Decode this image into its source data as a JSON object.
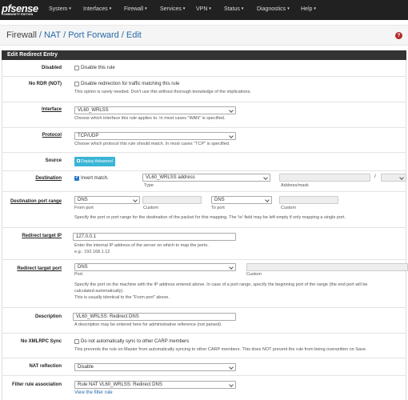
{
  "brand": {
    "logo_text": "pfsense",
    "edition": "COMMUNITY EDITION"
  },
  "nav": [
    "System",
    "Interfaces",
    "Firewall",
    "Services",
    "VPN",
    "Status",
    "Diagnostics",
    "Help"
  ],
  "breadcrumb": {
    "part1": "Firewall",
    "part2": "NAT",
    "part3": "Port Forward",
    "part4": "Edit"
  },
  "panel_title": "Edit Redirect Entry",
  "disabled": {
    "label": "Disabled",
    "checkbox_text": "Disable this rule",
    "checked": false
  },
  "no_rdr": {
    "label": "No RDR (NOT)",
    "checkbox_text": "Disable redirection for traffic matching this rule",
    "help": "This option is rarely needed. Don't use this without thorough knowledge of the implications.",
    "checked": false
  },
  "interface": {
    "label": "Interface",
    "value": "VL60_WRLSS",
    "help": "Choose which interface this rule applies to. In most cases \"WAN\" is specified."
  },
  "protocol": {
    "label": "Protocol",
    "value": "TCP/UDP",
    "help": "Choose which protocol this rule should match. In most cases \"TCP\" is specified."
  },
  "source": {
    "label": "Source",
    "button": "Display Advanced"
  },
  "destination": {
    "label": "Destination",
    "invert_text": "Invert match.",
    "invert_checked": true,
    "type_value": "VL60_WRLSS address",
    "type_caption": "Type",
    "addr_caption": "Address/mask",
    "slash": "/"
  },
  "dest_port_range": {
    "label": "Destination port range",
    "from_value": "DNS",
    "to_value": "DNS",
    "from_caption": "From port",
    "custom_caption": "Custom",
    "to_caption": "To port",
    "custom_caption2": "Custom",
    "help": "Specify the port or port range for the destination of the packet for this mapping. The 'to' field may be left empty if only mapping a single port."
  },
  "redirect_ip": {
    "label": "Redirect target IP",
    "value": "127.0.0.1",
    "help1": "Enter the internal IP address of the server on which to map the ports.",
    "help2": "e.g.: 192.168.1.12"
  },
  "redirect_port": {
    "label": "Redirect target port",
    "value": "DNS",
    "port_caption": "Port",
    "custom_caption": "Custom",
    "help1": "Specify the port on the machine with the IP address entered above. In case of a port range, specify the beginning port of the range (the end port will be",
    "help2": "calculated automatically).",
    "help3": "This is usually identical to the \"From port\" above."
  },
  "description": {
    "label": "Description",
    "value": "VL60_WRLSS: Redirect DNS",
    "help": "A description may be entered here for administrative reference (not parsed)"
  },
  "no_xmlrpc": {
    "label": "No XMLRPC Sync",
    "checkbox_text": "Do not automatically sync to other CARP members",
    "help": "This prevents the rule on Master from automatically syncing to other CARP members. This does NOT prevent the rule from being overwritten on Save.",
    "checked": false
  },
  "nat_reflection": {
    "label": "NAT reflection",
    "value": "Disable"
  },
  "filter_rule": {
    "label": "Filter rule association",
    "value": "Rule NAT VL60_WRLSS: Redirect DNS",
    "link": "View the filter rule"
  },
  "colors": {
    "navbar": "#212121",
    "panel_header": "#333333",
    "link": "#2a6aa8",
    "help_icon": "#b42a2a",
    "advanced_button": "#3ab5d5",
    "checkbox_checked": "#2979c6"
  }
}
